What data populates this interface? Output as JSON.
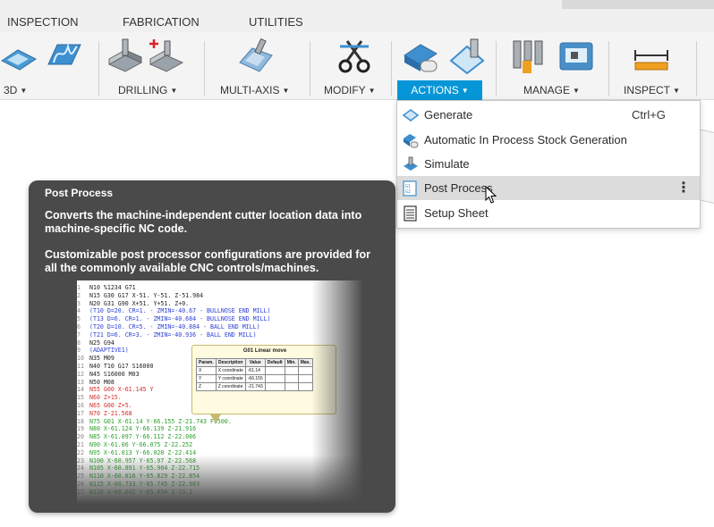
{
  "ribbon": {
    "tabs": [
      "INSPECTION",
      "FABRICATION",
      "UTILITIES"
    ],
    "groups": {
      "g3d": "3D",
      "drilling": "DRILLING",
      "multiaxis": "MULTI-AXIS",
      "modify": "MODIFY",
      "actions": "ACTIONS",
      "manage": "MANAGE",
      "inspect": "INSPECT"
    },
    "accent": "#0696d7"
  },
  "menu": {
    "items": [
      {
        "label": "Generate",
        "shortcut": "Ctrl+G",
        "icon": "generate-icon"
      },
      {
        "label": "Automatic In Process Stock Generation",
        "icon": "stock-generation-icon"
      },
      {
        "label": "Simulate",
        "icon": "simulate-icon"
      },
      {
        "label": "Post Process",
        "icon": "post-process-icon",
        "more": "⋮"
      },
      {
        "label": "Setup Sheet",
        "icon": "setup-sheet-icon"
      }
    ]
  },
  "tooltip": {
    "title": "Post Process",
    "p1": "Converts the machine-independent cutter location data into machine-specific NC code.",
    "p2": "Customizable post processor configurations are provided for all the commonly available CNC controls/machines.",
    "nc_lines": [
      {
        "n": "1",
        "t": "N10 %1234 G71",
        "c": "#222222"
      },
      {
        "n": "2",
        "t": "N15 G30 G17 X-51. Y-51. Z-51.984",
        "c": "#222222"
      },
      {
        "n": "3",
        "t": "N20 G31 G90 X+51. Y+51. Z+0.",
        "c": "#222222"
      },
      {
        "n": "4",
        "t": "(T10  D=20. CR=1. - ZMIN=-40.67 - BULLNOSE END MILL)",
        "c": "#2b3fd6"
      },
      {
        "n": "5",
        "t": "(T13  D=6. CR=1. - ZMIN=-40.684 - BULLNOSE END MILL)",
        "c": "#2b3fd6"
      },
      {
        "n": "6",
        "t": "(T20  D=10. CR=5. - ZMIN=-40.884 - BALL END MILL)",
        "c": "#2b3fd6"
      },
      {
        "n": "7",
        "t": "(T21  D=6. CR=3. - ZMIN=-40.936 - BALL END MILL)",
        "c": "#2b3fd6"
      },
      {
        "n": "8",
        "t": "N25 G94",
        "c": "#222222"
      },
      {
        "n": "9",
        "t": "(ADAPTIVE1)",
        "c": "#2b3fd6"
      },
      {
        "n": "10",
        "t": "N35 M09",
        "c": "#222222"
      },
      {
        "n": "11",
        "t": "N40 T10 G17 S16000",
        "c": "#222222"
      },
      {
        "n": "12",
        "t": "N45 S16000 M03",
        "c": "#222222"
      },
      {
        "n": "13",
        "t": "N50 M08",
        "c": "#222222"
      },
      {
        "n": "14",
        "t": "N55 G00 X-61.145 Y",
        "c": "#d62b2b"
      },
      {
        "n": "15",
        "t": "N60 Z+15.",
        "c": "#d62b2b"
      },
      {
        "n": "16",
        "t": "N65 G00 Z+5.",
        "c": "#d62b2b"
      },
      {
        "n": "17",
        "t": "N70 Z-21.568",
        "c": "#d62b2b"
      },
      {
        "n": "18",
        "t": "N75 G01 X-61.14 Y-66.155 Z-21.743 F9500.",
        "c": "#2aa02a"
      },
      {
        "n": "19",
        "t": "N80 X-61.124 Y-66.139 Z-21.916",
        "c": "#2aa02a"
      },
      {
        "n": "20",
        "t": "N85 X-61.097 Y-66.112 Z-22.086",
        "c": "#2aa02a"
      },
      {
        "n": "21",
        "t": "N90 X-61.06 Y-66.075 Z-22.252",
        "c": "#2aa02a"
      },
      {
        "n": "22",
        "t": "N95 X-61.013 Y-66.028 Z-22.414",
        "c": "#2aa02a"
      },
      {
        "n": "23",
        "t": "N100 X-60.957 Y-65.97 Z-22.568",
        "c": "#2aa02a"
      },
      {
        "n": "24",
        "t": "N105 X-60.891 Y-65.904 Z-22.715",
        "c": "#2aa02a"
      },
      {
        "n": "25",
        "t": "N110 X-60.816 Y-65.829 Z-22.854",
        "c": "#2aa02a"
      },
      {
        "n": "26",
        "t": "N115 X-60.733 Y-65.745 Z-22.983",
        "c": "#2aa02a"
      },
      {
        "n": "27",
        "t": "N120 X-60.642 Y-65.654 Z-23.1",
        "c": "#2aa02a"
      }
    ],
    "popup": {
      "title": "G01 Linear move",
      "headers": [
        "Param.",
        "Description",
        "Value",
        "Default",
        "Min.",
        "Max."
      ],
      "rows": [
        [
          "X",
          "X coordinate",
          "-61.14",
          "",
          "",
          ""
        ],
        [
          "Y",
          "Y coordinate",
          "-66.155",
          "",
          "",
          ""
        ],
        [
          "Z",
          "Z coordinate",
          "-21.743",
          "",
          "",
          ""
        ]
      ]
    }
  }
}
